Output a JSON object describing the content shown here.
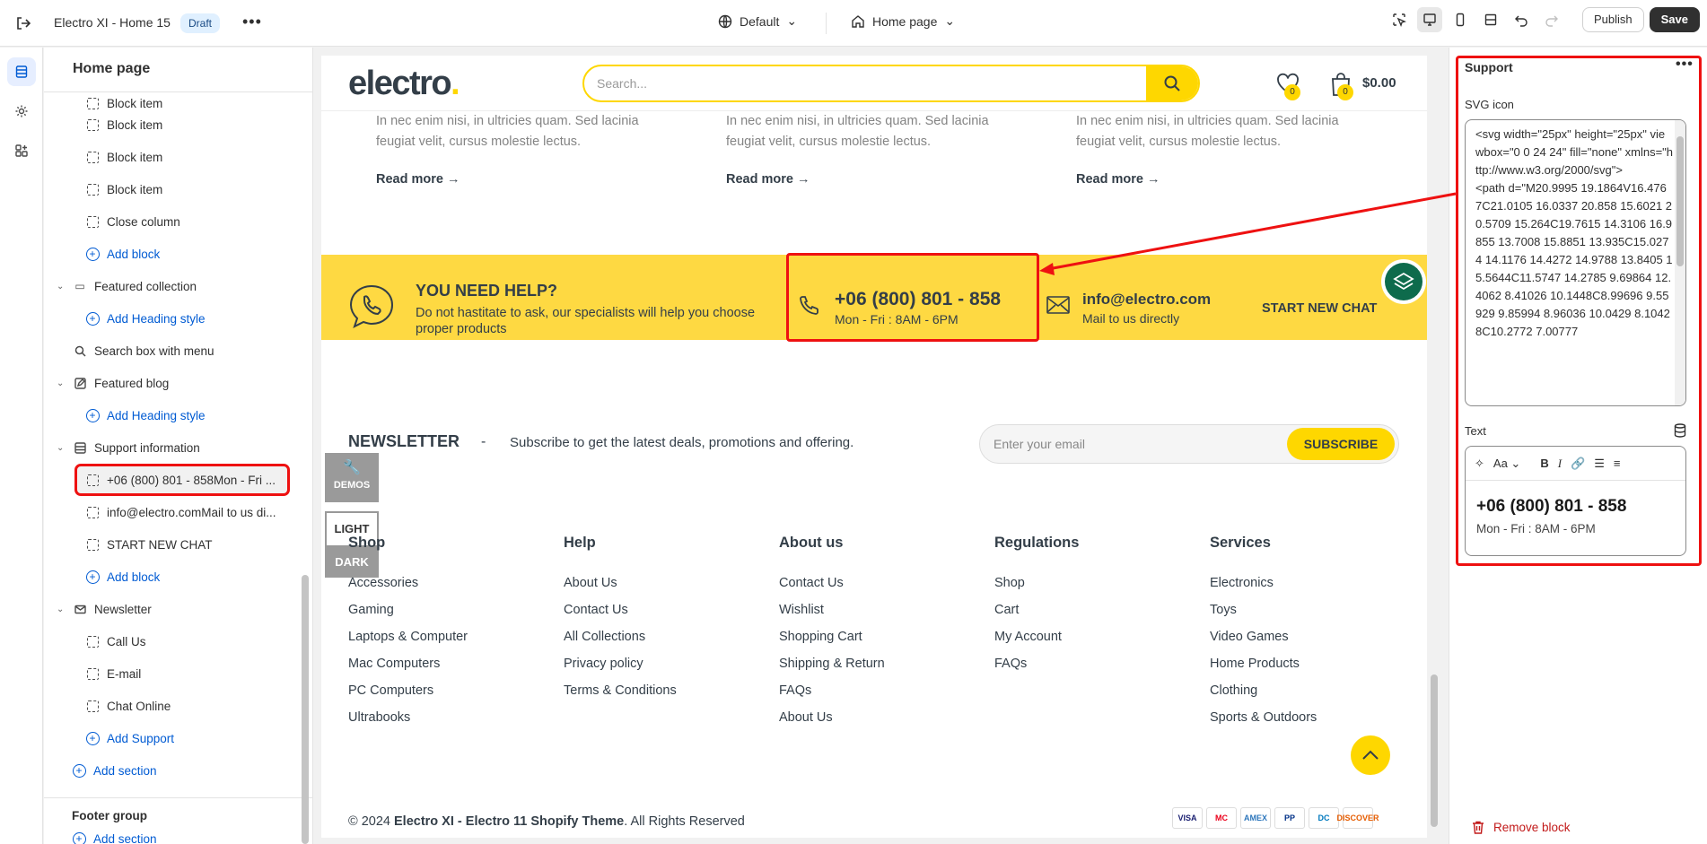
{
  "topbar": {
    "title": "Electro XI - Home 15",
    "status_badge": "Draft",
    "more": "•••",
    "theme_selector": "Default",
    "page_selector": "Home page",
    "publish_label": "Publish",
    "save_label": "Save"
  },
  "sidebar": {
    "title": "Home page",
    "items": [
      {
        "label": "Block item"
      },
      {
        "label": "Block item"
      },
      {
        "label": "Block item"
      },
      {
        "label": "Block item"
      },
      {
        "label": "Close column"
      },
      {
        "label": "Add block"
      },
      {
        "label": "Featured collection"
      },
      {
        "label": "Add Heading style"
      },
      {
        "label": "Search box with menu"
      },
      {
        "label": "Featured blog"
      },
      {
        "label": "Add Heading style"
      },
      {
        "label": "Support information"
      },
      {
        "label": "+06 (800) 801 - 858Mon - Fri ..."
      },
      {
        "label": "info@electro.comMail to us di..."
      },
      {
        "label": "START NEW CHAT"
      },
      {
        "label": "Add block"
      },
      {
        "label": "Newsletter"
      },
      {
        "label": "Call Us"
      },
      {
        "label": "E-mail"
      },
      {
        "label": "Chat Online"
      },
      {
        "label": "Add Support"
      },
      {
        "label": "Add section"
      }
    ],
    "footer_group": "Footer group",
    "footer_add": "Add section"
  },
  "preview": {
    "logo": "electro",
    "logo_dot": ".",
    "search_placeholder": "Search...",
    "wishlist_count": "0",
    "cart_count": "0",
    "cart_total": "$0.00",
    "blog_excerpt": "In nec enim nisi, in ultricies quam. Sed lacinia feugiat velit, cursus molestie lectus.",
    "read_more": "Read more",
    "help": {
      "title": "YOU NEED HELP?",
      "desc": "Do not hastitate to ask, our specialists will help you choose proper products",
      "phone": "+06 (800) 801 - 858",
      "hours": "Mon - Fri : 8AM - 6PM",
      "email": "info@electro.com",
      "email_sub": "Mail to us directly",
      "chat": "START NEW CHAT"
    },
    "newsletter": {
      "title": "NEWSLETTER",
      "dash": "-",
      "text": "Subscribe to get the latest deals, promotions and offering.",
      "placeholder": "Enter your email",
      "button": "SUBSCRIBE"
    },
    "demo_label": "DEMOS",
    "light_label": "LIGHT",
    "dark_label": "DARK",
    "footer_cols": [
      {
        "heading": "Shop",
        "links": [
          "Accessories",
          "Gaming",
          "Laptops & Computer",
          "Mac Computers",
          "PC Computers",
          "Ultrabooks"
        ]
      },
      {
        "heading": "Help",
        "links": [
          "About Us",
          "Contact Us",
          "All Collections",
          "Privacy policy",
          "Terms & Conditions"
        ]
      },
      {
        "heading": "About us",
        "links": [
          "Contact Us",
          "Wishlist",
          "Shopping Cart",
          "Shipping & Return",
          "FAQs",
          "About Us"
        ]
      },
      {
        "heading": "Regulations",
        "links": [
          "Shop",
          "Cart",
          "My Account",
          "FAQs"
        ]
      },
      {
        "heading": "Services",
        "links": [
          "Electronics",
          "Toys",
          "Video Games",
          "Home Products",
          "Clothing",
          "Sports & Outdoors"
        ]
      }
    ],
    "copyright_prefix": "© 2024 ",
    "copyright_brand": "Electro XI - Electro 11 Shopify Theme",
    "copyright_suffix": ". All Rights Reserved",
    "payments": [
      "VISA",
      "MC",
      "AMEX",
      "PP",
      "DC",
      "DISCOVER"
    ]
  },
  "settings": {
    "title": "Support",
    "svg_icon_label": "SVG icon",
    "svg_code": "<svg width=\"25px\" height=\"25px\" viewbox=\"0 0 24 24\" fill=\"none\" xmlns=\"http://www.w3.org/2000/svg\">\n<path d=\"M20.9995 19.1864V16.4767C21.0105 16.0337 20.858 15.6021 20.5709 15.264C19.7615 14.3106 16.9855 13.7008 15.8851 13.935C15.0274 14.1176 14.4272 14.9788 13.8405 15.5644C11.5747 14.2785 9.69864 12.4062 8.41026 10.1448C8.99696 9.55929 9.85994 8.96036 10.0429 8.10428C10.2772 7.00777",
    "text_label": "Text",
    "rte_phone": "+06 (800) 801 - 858",
    "rte_hours": "Mon - Fri : 8AM - 6PM",
    "remove_label": "Remove block"
  },
  "colors": {
    "accent_yellow": "#fed700",
    "help_bar": "#fed942",
    "annotation_red": "#ee1111",
    "link_blue": "#005bd3"
  }
}
